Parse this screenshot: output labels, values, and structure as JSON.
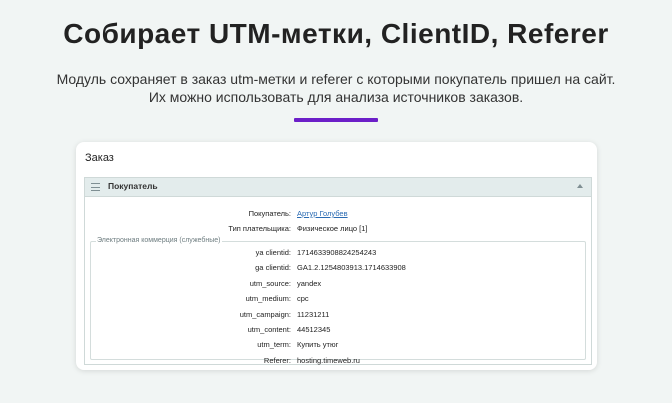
{
  "hero": {
    "title": "Собирает UTM-метки, ClientID, Referer",
    "subtitle_line1": "Модуль сохраняет в заказ utm-метки и referer с которыми покупатель пришел на сайт.",
    "subtitle_line2": "Их можно использовать для анализа источников заказов.",
    "accent_color": "#6c1fc8"
  },
  "card": {
    "title": "Заказ",
    "panel": {
      "title": "Покупатель",
      "fields": [
        {
          "label": "Покупатель:",
          "value": "Артур Голубев",
          "link": true
        },
        {
          "label": "Тип плательщика:",
          "value": "Физическое лицо [1]",
          "link": false
        }
      ],
      "ecommerce": {
        "legend": "Электронная коммерция (служебные)",
        "rows": [
          {
            "label": "ya clientid:",
            "value": "1714633908824254243"
          },
          {
            "label": "ga clientid:",
            "value": "GA1.2.1254803913.1714633908"
          },
          {
            "label": "utm_source:",
            "value": "yandex"
          },
          {
            "label": "utm_medium:",
            "value": "cpc"
          },
          {
            "label": "utm_campaign:",
            "value": "11231211"
          },
          {
            "label": "utm_content:",
            "value": "44512345"
          },
          {
            "label": "utm_term:",
            "value": "Купить утюг"
          },
          {
            "label": "Referer:",
            "value": "hosting.timeweb.ru"
          }
        ]
      }
    }
  }
}
